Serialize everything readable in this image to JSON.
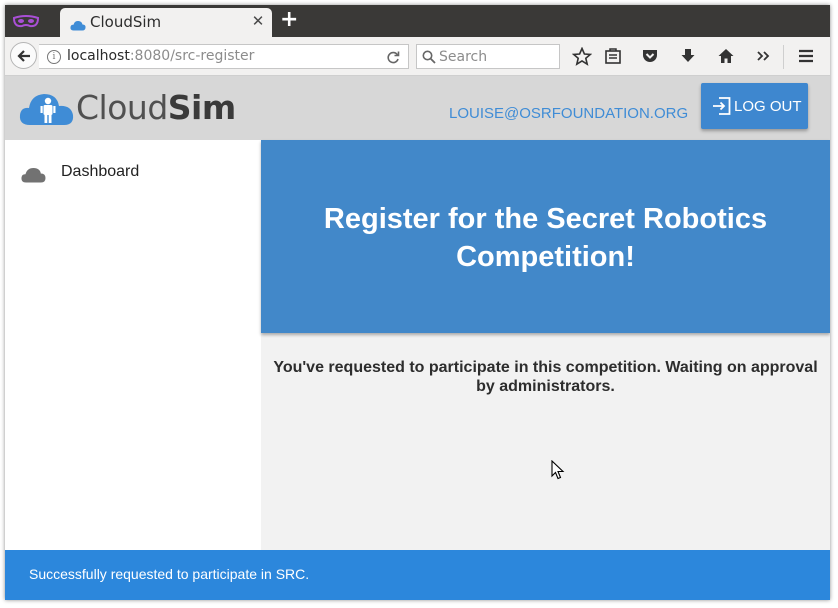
{
  "browser": {
    "tab_title": "CloudSim",
    "url_host": "localhost",
    "url_rest": ":8080/src-register",
    "search_placeholder": "Search"
  },
  "header": {
    "logo_light": "Cloud",
    "logo_bold": "Sim",
    "user_email": "LOUISE@OSRFOUNDATION.ORG",
    "logout_label": "LOG OUT"
  },
  "sidebar": {
    "items": [
      {
        "label": "Dashboard",
        "icon": "cloud-icon"
      }
    ]
  },
  "main": {
    "title": "Register for the Secret Robotics Competition!",
    "message": "You've requested to participate in this competition. Waiting on approval by administrators."
  },
  "toast": {
    "text": "Successfully requested to participate in SRC."
  },
  "colors": {
    "accent": "#4288c9",
    "toast": "#2c87dc",
    "header_bg": "#d7d7d7",
    "link": "#3f8cd6"
  }
}
